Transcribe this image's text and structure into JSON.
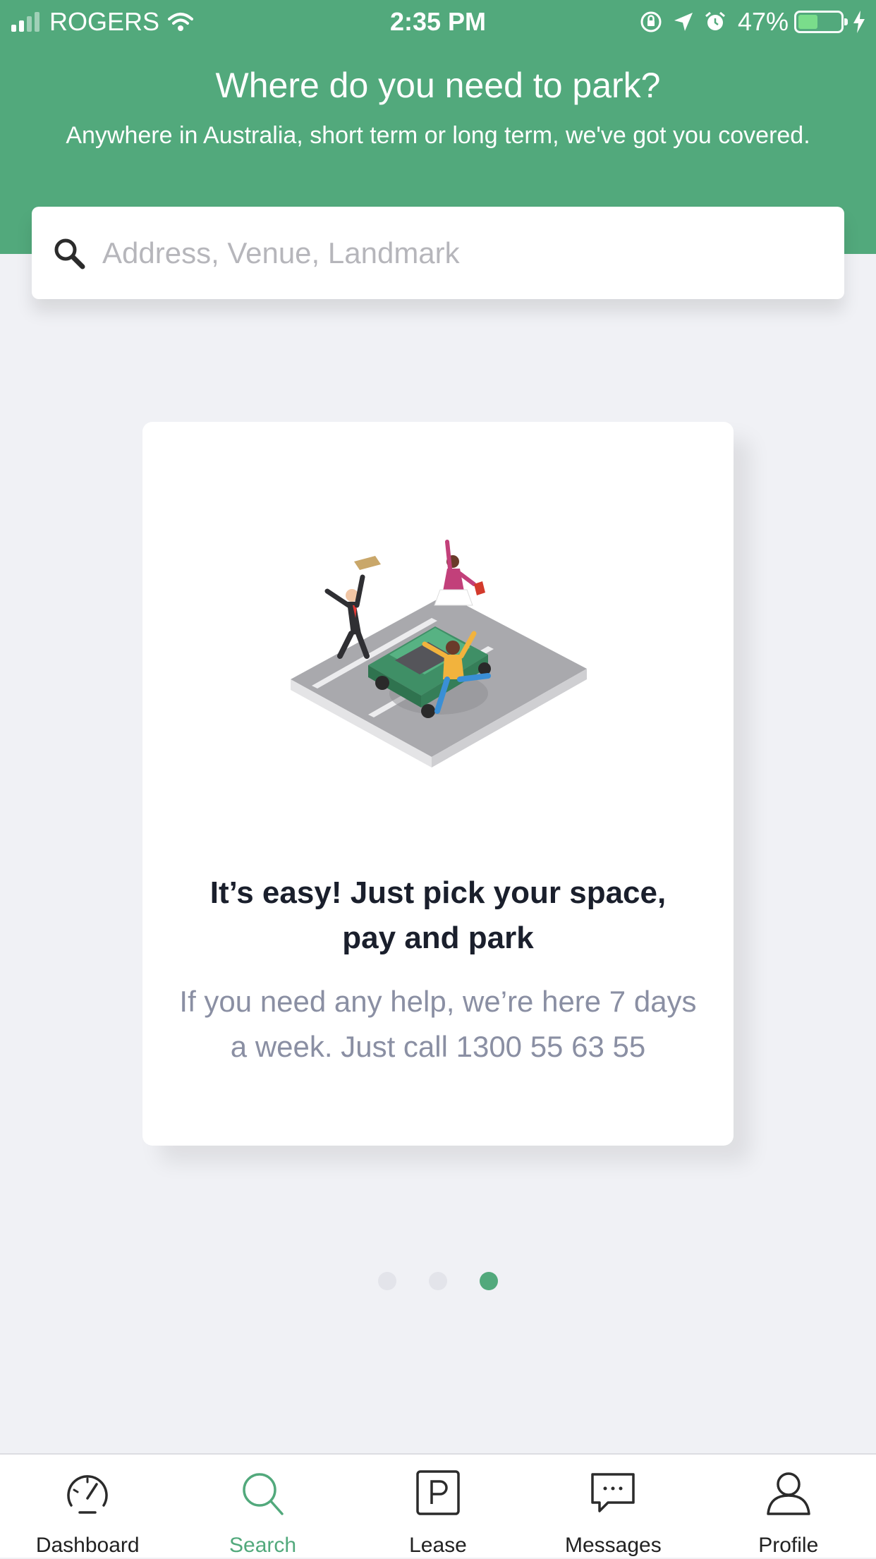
{
  "status_bar": {
    "carrier": "ROGERS",
    "time": "2:35 PM",
    "battery": "47%",
    "battery_level": 0.47,
    "icons": [
      "signal-icon",
      "wifi-icon",
      "rotation-lock-icon",
      "location-icon",
      "alarm-icon",
      "battery-icon",
      "charging-icon"
    ]
  },
  "header": {
    "title": "Where do you need to park?",
    "subtitle": "Anywhere in Australia, short term or long term, we've got you covered."
  },
  "search": {
    "placeholder": "Address, Venue, Landmark",
    "icon": "search-icon"
  },
  "card": {
    "title": "It’s easy! Just pick your space, pay and park",
    "text": "If you need any help, we’re here 7 days a week. Just call 1300 55 63 55"
  },
  "pager": {
    "count": 3,
    "active_index": 2
  },
  "tabbar": {
    "items": [
      {
        "label": "Dashboard",
        "icon": "dashboard-icon",
        "active": false
      },
      {
        "label": "Search",
        "icon": "search-icon",
        "active": true
      },
      {
        "label": "Lease",
        "icon": "parking-icon",
        "active": false
      },
      {
        "label": "Messages",
        "icon": "messages-icon",
        "active": false
      },
      {
        "label": "Profile",
        "icon": "profile-icon",
        "active": false
      }
    ]
  },
  "colors": {
    "brand_green": "#52a97c",
    "background": "#f0f1f5",
    "title_text": "#1a1f2c",
    "body_text": "#8a8fa3"
  }
}
